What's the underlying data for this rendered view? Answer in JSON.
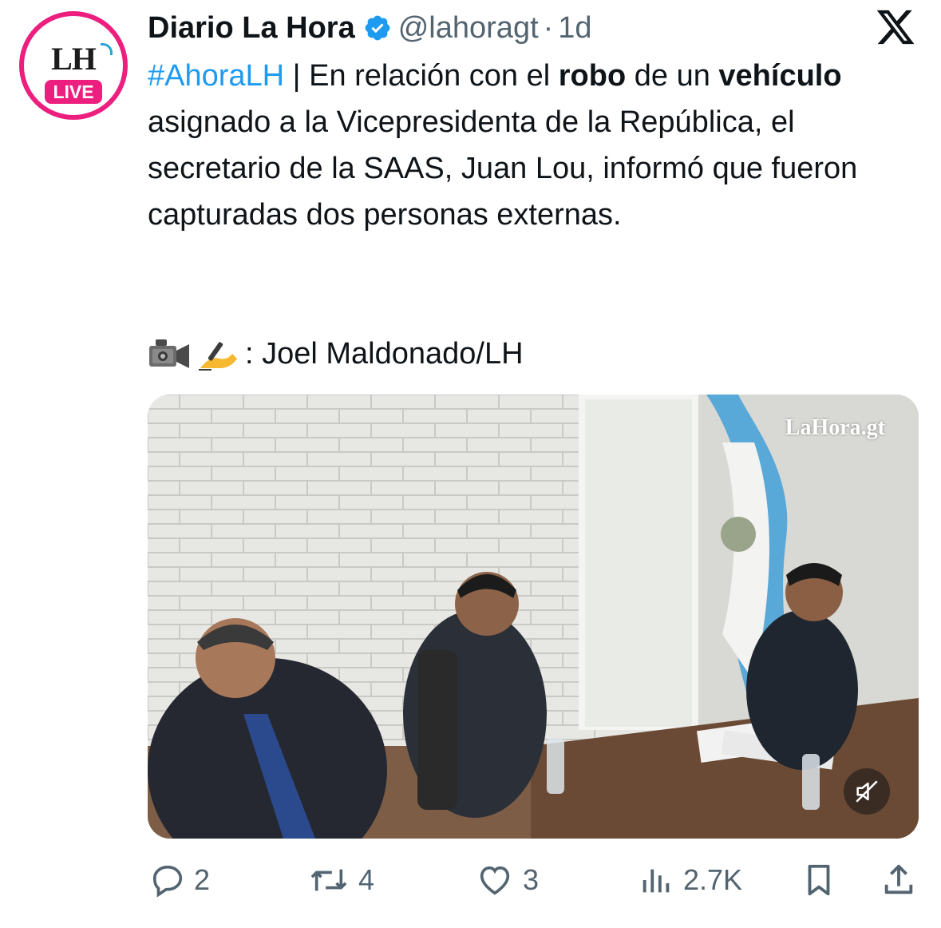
{
  "account": {
    "display_name": "Diario La Hora",
    "handle": "@lahoragt",
    "separator": "·",
    "time": "1d",
    "avatar_text": "LH",
    "avatar_badge": "LIVE"
  },
  "tweet": {
    "hashtag": "#AhoraLH",
    "segments": [
      " | En relación con el ",
      "robo",
      " de un ",
      "vehículo",
      " asignado a la Vicepresidenta de la República, el secretario de la SAAS, Juan Lou, informó que fueron capturadas dos personas externas."
    ],
    "credit": ": Joel Maldonado/LH"
  },
  "media": {
    "watermark": "LaHora.gt"
  },
  "actions": {
    "replies": "2",
    "reposts": "4",
    "likes": "3",
    "views": "2.7K"
  },
  "colors": {
    "accent": "#1d9bf0",
    "brand_pink": "#ec1f7e",
    "muted_text": "#536471"
  }
}
